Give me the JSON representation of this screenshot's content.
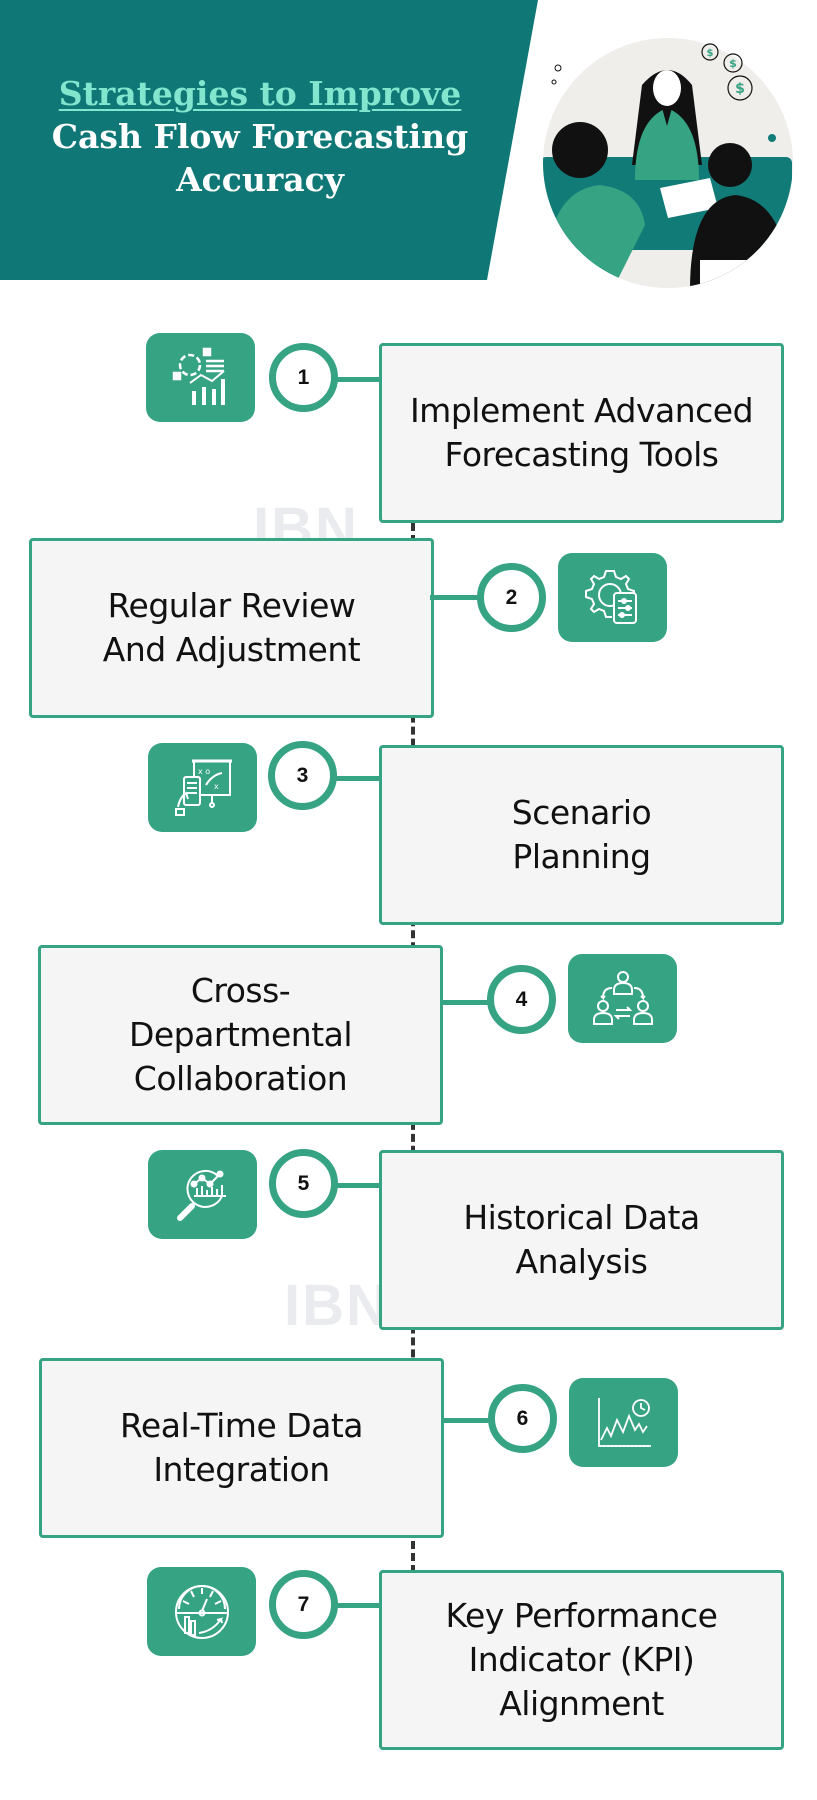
{
  "header": {
    "title_line1": "Strategies to Improve",
    "title_line2": "Cash Flow Forecasting",
    "title_line3": "Accuracy",
    "illustration": "business-meeting-illustration"
  },
  "colors": {
    "header_teal": "#0f7776",
    "title_accent": "#82e6cf",
    "brand_green": "#36a383",
    "box_fill": "#f5f5f5"
  },
  "watermark": "IBN",
  "steps": [
    {
      "number": "1",
      "label": "Implement Advanced Forecasting Tools",
      "icon": "analytics-chart-icon"
    },
    {
      "number": "2",
      "label": "Regular Review And Adjustment",
      "icon": "gear-settings-icon"
    },
    {
      "number": "3",
      "label": "Scenario Planning",
      "icon": "strategy-board-icon"
    },
    {
      "number": "4",
      "label": "Cross-Departmental Collaboration",
      "icon": "team-collaboration-icon"
    },
    {
      "number": "5",
      "label": "Historical Data Analysis",
      "icon": "magnifier-chart-icon"
    },
    {
      "number": "6",
      "label": "Real-Time Data Integration",
      "icon": "realtime-chart-icon"
    },
    {
      "number": "7",
      "label": "Key Performance Indicator (KPI) Alignment",
      "icon": "gauge-kpi-icon"
    }
  ]
}
